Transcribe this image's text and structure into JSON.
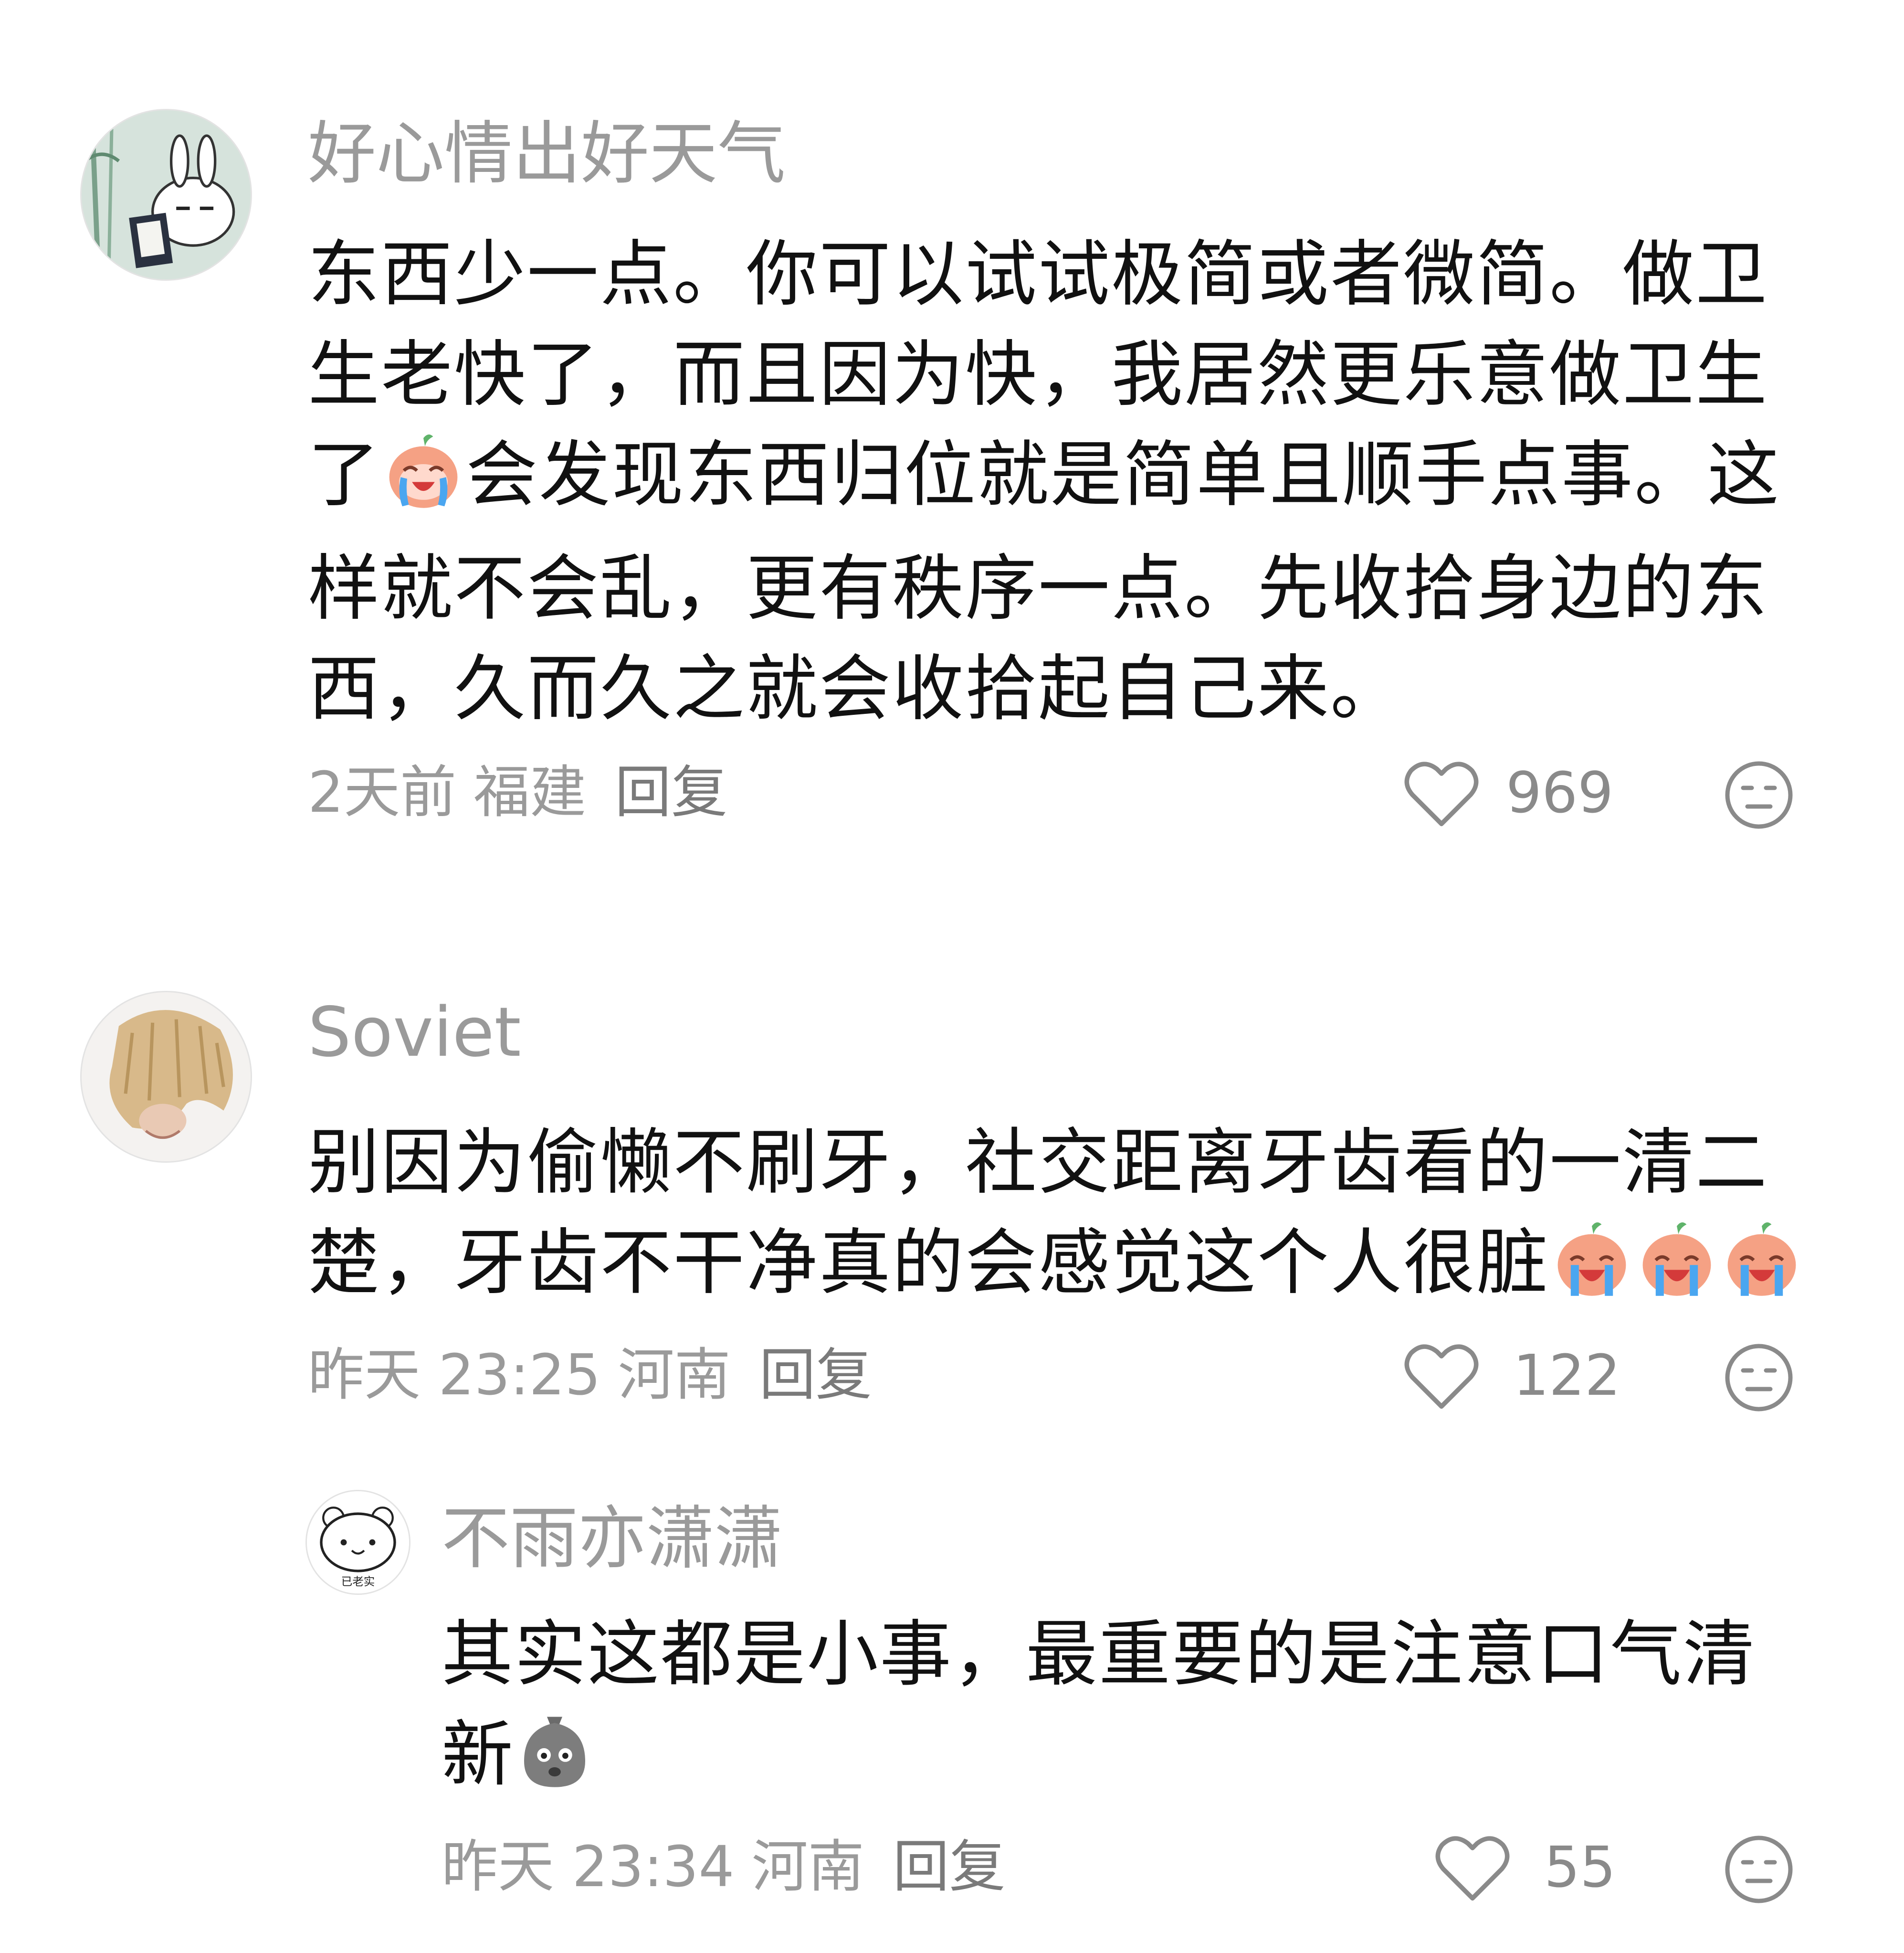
{
  "comments": [
    {
      "username": "好心情出好天气",
      "text_lines": [
        "东西少一点。你可以试试极简或者微简。做卫",
        "生老快了，而且因为快，我居然更乐意做卫生",
        "了",
        "会发现东西归位就是简单且顺手点事。这",
        "样就不会乱，更有秩序一点。先收拾身边的东",
        "西，久而久之就会收拾起自己来。"
      ],
      "time": "2天前",
      "region": "福建",
      "reply_label": "回复",
      "likes": "969",
      "avatar_icon": "bunny-reading-book-avatar"
    },
    {
      "username": "Soviet",
      "text_lines": [
        "别因为偷懒不刷牙，社交距离牙齿看的一清二",
        "楚，牙齿不干净真的会感觉这个人很脏"
      ],
      "time": "昨天 23:25",
      "region": "河南",
      "reply_label": "回复",
      "likes": "122",
      "avatar_icon": "blonde-hair-person-avatar"
    },
    {
      "username": "不雨亦潇潇",
      "text_lines": [
        "其实这都是小事，最重要的是注意口气清",
        "新"
      ],
      "time": "昨天 23:34",
      "region": "河南",
      "reply_label": "回复",
      "likes": "55",
      "avatar_icon": "white-bear-avatar",
      "avatar_caption": "已老实"
    }
  ],
  "colors": {
    "username": "#9a9a9a",
    "body_text": "#111111",
    "meta": "#9a9a9a",
    "emoji_peach": "#f5a184"
  }
}
